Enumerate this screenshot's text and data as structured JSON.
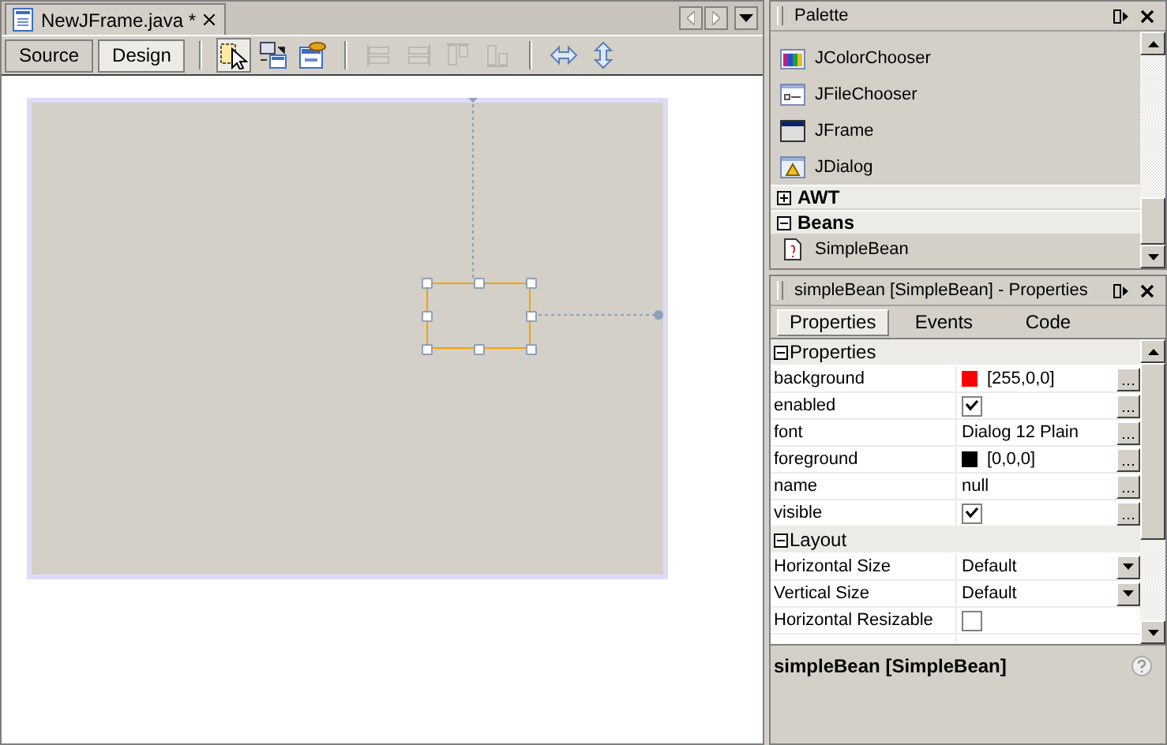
{
  "editor": {
    "tabs": [
      {
        "label": "NewJFrame.java *",
        "selected": true
      }
    ],
    "view_buttons": [
      {
        "label": "Source",
        "selected": false
      },
      {
        "label": "Design",
        "selected": true
      }
    ],
    "tools": [
      {
        "kind": "select",
        "selected": true,
        "disabled": false
      },
      {
        "kind": "connect",
        "selected": false,
        "disabled": false
      },
      {
        "kind": "preview",
        "selected": false,
        "disabled": false
      },
      {
        "kind": "align-left",
        "selected": false,
        "disabled": true
      },
      {
        "kind": "align-right",
        "selected": false,
        "disabled": true
      },
      {
        "kind": "align-top",
        "selected": false,
        "disabled": true
      },
      {
        "kind": "align-bottom",
        "selected": false,
        "disabled": true
      },
      {
        "kind": "resize-horizontal",
        "selected": false,
        "disabled": false
      },
      {
        "kind": "resize-vertical",
        "selected": false,
        "disabled": false
      }
    ]
  },
  "palette": {
    "title": "Palette",
    "items": [
      {
        "kind": "item",
        "label": "JColorChooser"
      },
      {
        "kind": "item",
        "label": "JFileChooser"
      },
      {
        "kind": "item",
        "label": "JFrame"
      },
      {
        "kind": "item",
        "label": "JDialog"
      },
      {
        "kind": "category",
        "label": "AWT",
        "expanded": false
      },
      {
        "kind": "category",
        "label": "Beans",
        "expanded": true,
        "children": [
          {
            "label": "SimpleBean"
          }
        ]
      }
    ]
  },
  "properties": {
    "title": "simpleBean [SimpleBean] - Properties",
    "tabs": [
      {
        "label": "Properties",
        "selected": true
      },
      {
        "label": "Events",
        "selected": false
      },
      {
        "label": "Code",
        "selected": false
      }
    ],
    "sections": [
      {
        "title": "Properties",
        "expanded": true,
        "rows": [
          {
            "name": "background",
            "kind": "color",
            "color": "#ff0000",
            "value": "[255,0,0]",
            "custom_editor": true
          },
          {
            "name": "enabled",
            "kind": "checkbox",
            "checked": true,
            "custom_editor": true
          },
          {
            "name": "font",
            "kind": "text",
            "value": "Dialog 12 Plain",
            "custom_editor": true
          },
          {
            "name": "foreground",
            "kind": "color",
            "color": "#000000",
            "value": "[0,0,0]",
            "custom_editor": true
          },
          {
            "name": "name",
            "kind": "text",
            "value": "null",
            "custom_editor": true
          },
          {
            "name": "visible",
            "kind": "checkbox",
            "checked": true,
            "custom_editor": true
          }
        ]
      },
      {
        "title": "Layout",
        "expanded": true,
        "rows": [
          {
            "name": "Horizontal Size",
            "kind": "dropdown",
            "value": "Default",
            "custom_editor": false
          },
          {
            "name": "Vertical Size",
            "kind": "dropdown",
            "value": "Default",
            "custom_editor": false
          },
          {
            "name": "Horizontal Resizable",
            "kind": "checkbox",
            "checked": false,
            "custom_editor": false
          }
        ]
      }
    ],
    "description": "simpleBean [SimpleBean]"
  }
}
